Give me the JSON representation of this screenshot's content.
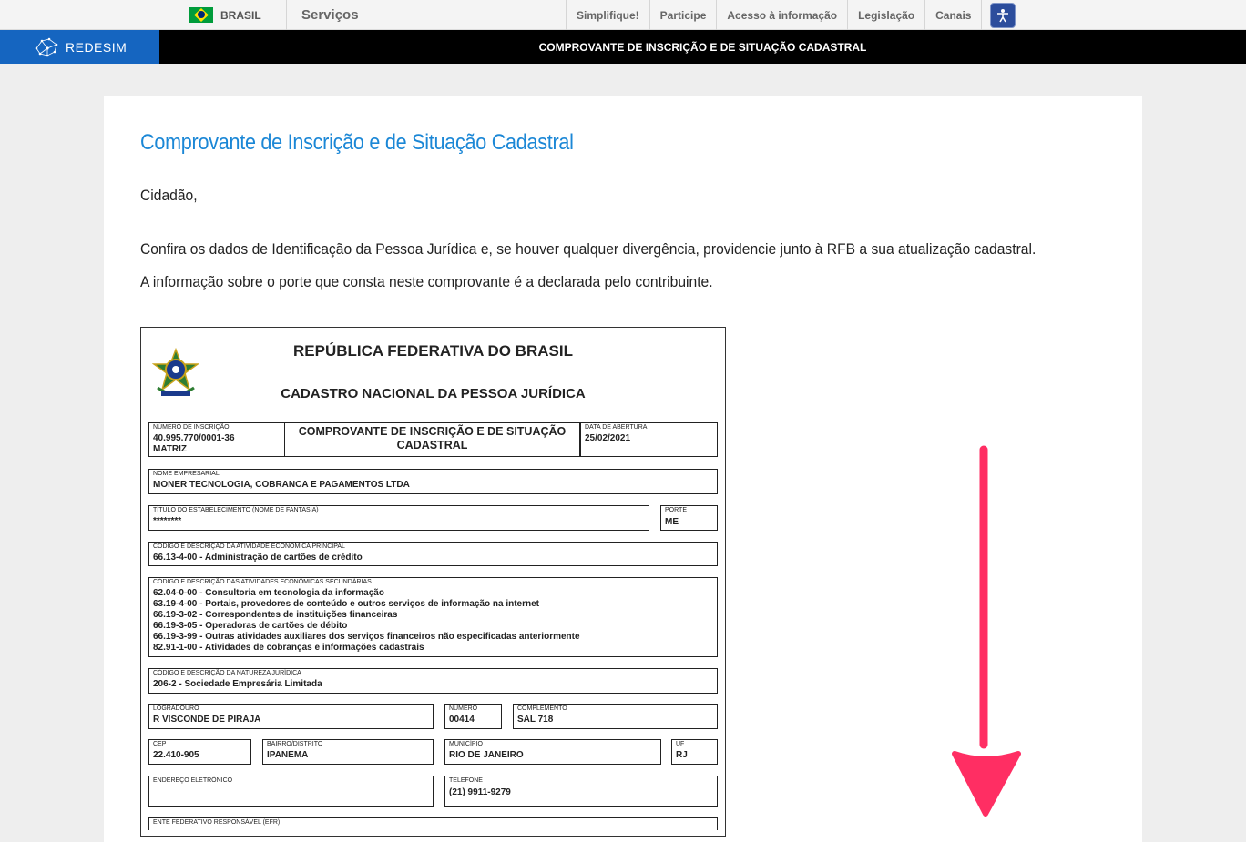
{
  "govbar": {
    "brasil_label": "BRASIL",
    "servicos_label": "Serviços",
    "nav": [
      "Simplifique!",
      "Participe",
      "Acesso à informação",
      "Legislação",
      "Canais"
    ]
  },
  "redesim": {
    "logo_text": "REDESIM",
    "title": "COMPROVANTE DE INSCRIÇÃO E DE SITUAÇÃO CADASTRAL"
  },
  "page": {
    "title": "Comprovante de Inscrição e de Situação Cadastral",
    "greeting": "Cidadão,",
    "para1": "Confira os dados de Identificação da Pessoa Jurídica e, se houver qualquer divergência, providencie junto à RFB a sua atualização cadastral.",
    "para2": "A informação sobre o porte que consta neste comprovante é a declarada pelo contribuinte."
  },
  "document": {
    "header1": "REPÚBLICA FEDERATIVA DO BRASIL",
    "header2": "CADASTRO NACIONAL DA PESSOA JURÍDICA",
    "comp_title": "COMPROVANTE DE INSCRIÇÃO E DE SITUAÇÃO CADASTRAL",
    "numero_inscricao": {
      "label": "NÚMERO DE INSCRIÇÃO",
      "value": "40.995.770/0001-36",
      "value2": "MATRIZ"
    },
    "data_abertura": {
      "label": "DATA DE ABERTURA",
      "value": "25/02/2021"
    },
    "nome_empresarial": {
      "label": "NOME EMPRESARIAL",
      "value": "MONER TECNOLOGIA, COBRANCA E PAGAMENTOS LTDA"
    },
    "titulo_estabelecimento": {
      "label": "TÍTULO DO ESTABELECIMENTO (NOME DE FANTASIA)",
      "value": "********"
    },
    "porte": {
      "label": "PORTE",
      "value": "ME"
    },
    "atividade_principal": {
      "label": "CÓDIGO E DESCRIÇÃO DA ATIVIDADE ECONÔMICA PRINCIPAL",
      "value": "66.13-4-00 - Administração de cartões de crédito"
    },
    "atividades_secundarias": {
      "label": "CÓDIGO E DESCRIÇÃO DAS ATIVIDADES ECONÔMICAS SECUNDÁRIAS",
      "items": [
        "62.04-0-00 - Consultoria em tecnologia da informação",
        "63.19-4-00 - Portais, provedores de conteúdo e outros serviços de informação na internet",
        "66.19-3-02 - Correspondentes de instituições financeiras",
        "66.19-3-05 - Operadoras de cartões de débito",
        "66.19-3-99 - Outras atividades auxiliares dos serviços financeiros não especificadas anteriormente",
        "82.91-1-00 - Atividades de cobranças e informações cadastrais"
      ]
    },
    "natureza_juridica": {
      "label": "CÓDIGO E DESCRIÇÃO DA NATUREZA JURÍDICA",
      "value": "206-2 - Sociedade Empresária Limitada"
    },
    "logradouro": {
      "label": "LOGRADOURO",
      "value": "R VISCONDE DE PIRAJA"
    },
    "numero": {
      "label": "NÚMERO",
      "value": "00414"
    },
    "complemento": {
      "label": "COMPLEMENTO",
      "value": "SAL 718"
    },
    "cep": {
      "label": "CEP",
      "value": "22.410-905"
    },
    "bairro": {
      "label": "BAIRRO/DISTRITO",
      "value": "IPANEMA"
    },
    "municipio": {
      "label": "MUNICÍPIO",
      "value": "RIO DE JANEIRO"
    },
    "uf": {
      "label": "UF",
      "value": "RJ"
    },
    "endereco_eletronico": {
      "label": "ENDEREÇO ELETRÔNICO",
      "value": ""
    },
    "telefone": {
      "label": "TELEFONE",
      "value": "(21) 9911-9279"
    },
    "efr": {
      "label": "ENTE FEDERATIVO RESPONSÁVEL (EFR)",
      "value": ""
    }
  },
  "colors": {
    "title_blue": "#1b87d6",
    "redesim_blue": "#1565c0",
    "arrow_pink": "#ff2e63"
  }
}
